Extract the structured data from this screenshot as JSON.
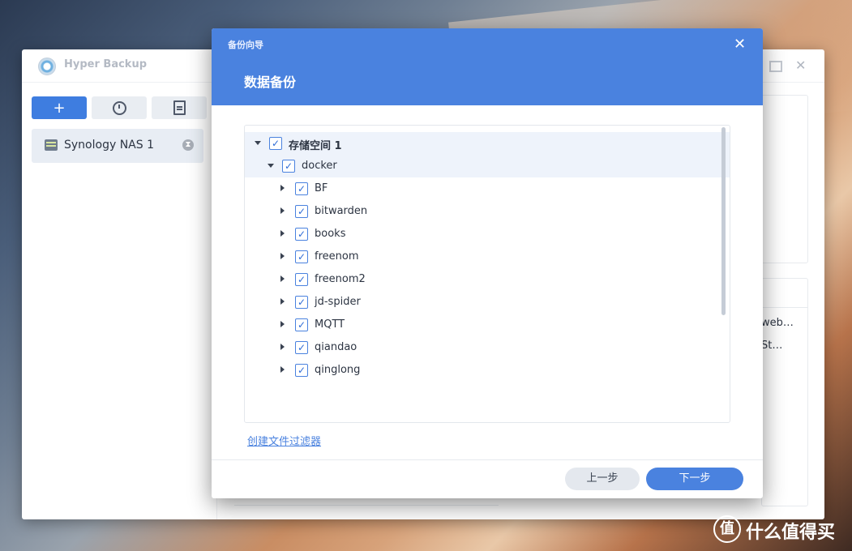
{
  "main_window": {
    "app_title": "Hyper Backup",
    "toolbar": {
      "add_icon": "plus-icon",
      "history_icon": "history-icon",
      "log_icon": "document-icon"
    },
    "task": {
      "label": "Synology NAS 1",
      "icon": "nas-icon",
      "status_icon": "hourglass-icon"
    },
    "background_text_1": "web…",
    "background_text_2": "St…"
  },
  "modal": {
    "small_title": "备份向导",
    "title": "数据备份",
    "close_glyph": "✕",
    "tree": [
      {
        "label": "存储空间 1",
        "level": 0,
        "expanded": true,
        "checked": true
      },
      {
        "label": "docker",
        "level": 1,
        "expanded": true,
        "checked": true
      },
      {
        "label": "BF",
        "level": 2,
        "expanded": false,
        "checked": true
      },
      {
        "label": "bitwarden",
        "level": 2,
        "expanded": false,
        "checked": true
      },
      {
        "label": "books",
        "level": 2,
        "expanded": false,
        "checked": true
      },
      {
        "label": "freenom",
        "level": 2,
        "expanded": false,
        "checked": true
      },
      {
        "label": "freenom2",
        "level": 2,
        "expanded": false,
        "checked": true
      },
      {
        "label": "jd-spider",
        "level": 2,
        "expanded": false,
        "checked": true
      },
      {
        "label": "MQTT",
        "level": 2,
        "expanded": false,
        "checked": true
      },
      {
        "label": "qiandao",
        "level": 2,
        "expanded": false,
        "checked": true
      },
      {
        "label": "qinglong",
        "level": 2,
        "expanded": false,
        "checked": true
      }
    ],
    "filter_link": "创建文件过滤器",
    "prev_button": "上一步",
    "next_button": "下一步"
  },
  "watermark": {
    "glyph": "值",
    "text": "什么值得买"
  },
  "colors": {
    "accent": "#4a82df",
    "header": "#4a82df"
  }
}
